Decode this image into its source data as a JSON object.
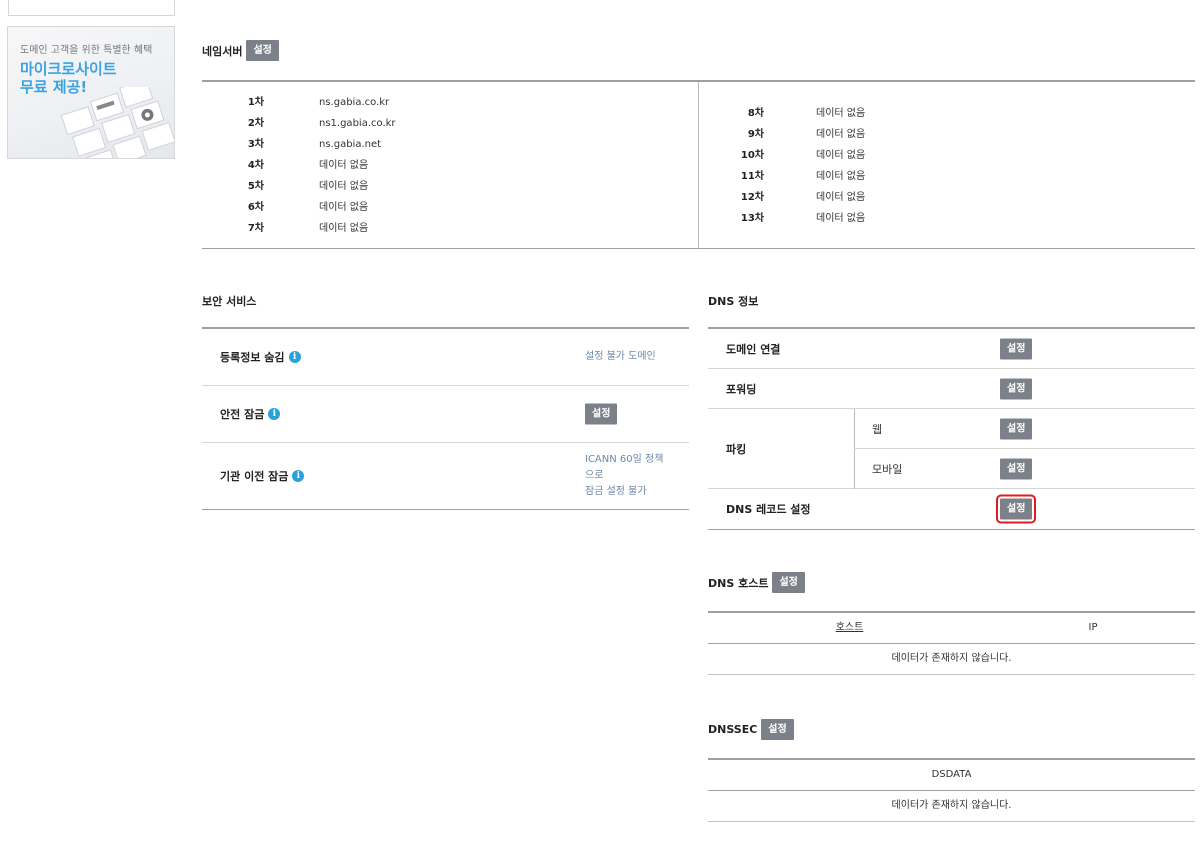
{
  "sidebar": {
    "banner": {
      "subtitle": "도메인 고객을 위한 특별한 혜택",
      "title_line1": "마이크로사이트",
      "title_line2": "무료 제공!"
    }
  },
  "nameserver": {
    "title": "네임서버",
    "button": "설정",
    "left": [
      {
        "order": "1차",
        "value": "ns.gabia.co.kr"
      },
      {
        "order": "2차",
        "value": "ns1.gabia.co.kr"
      },
      {
        "order": "3차",
        "value": "ns.gabia.net"
      },
      {
        "order": "4차",
        "value": "데이터 없음"
      },
      {
        "order": "5차",
        "value": "데이터 없음"
      },
      {
        "order": "6차",
        "value": "데이터 없음"
      },
      {
        "order": "7차",
        "value": "데이터 없음"
      }
    ],
    "right": [
      {
        "order": "8차",
        "value": "데이터 없음"
      },
      {
        "order": "9차",
        "value": "데이터 없음"
      },
      {
        "order": "10차",
        "value": "데이터 없음"
      },
      {
        "order": "11차",
        "value": "데이터 없음"
      },
      {
        "order": "12차",
        "value": "데이터 없음"
      },
      {
        "order": "13차",
        "value": "데이터 없음"
      }
    ]
  },
  "security": {
    "title": "보안 서비스",
    "rows": [
      {
        "label": "등록정보 숨김",
        "value": "설정 불가 도메인"
      },
      {
        "label": "안전 잠금",
        "button": "설정"
      },
      {
        "label": "기관 이전 잠금",
        "value_lines": [
          "ICANN 60일 정책",
          "으로",
          "잠금 설정 불가"
        ]
      }
    ]
  },
  "dns_info": {
    "title": "DNS 정보",
    "domain_connect": {
      "label": "도메인 연결",
      "button": "설정"
    },
    "forwarding": {
      "label": "포워딩",
      "button": "설정"
    },
    "parking": {
      "label": "파킹",
      "web": {
        "label": "웹",
        "button": "설정"
      },
      "mobile": {
        "label": "모바일",
        "button": "설정"
      }
    },
    "dns_record": {
      "label": "DNS 레코드 설정",
      "button": "설정"
    }
  },
  "dns_host": {
    "title": "DNS 호스트",
    "button": "설정",
    "columns": [
      "호스트",
      "IP"
    ],
    "empty": "데이터가 존재하지 않습니다."
  },
  "dnssec": {
    "title": "DNSSEC",
    "button": "설정",
    "columns": [
      "DSDATA"
    ],
    "empty": "데이터가 존재하지 않습니다."
  },
  "colors": {
    "button_bg": "#7c8088",
    "info_icon": "#29a1d9",
    "link_text": "#6f87a6",
    "highlight": "#e01b1b",
    "banner_title": "#3aa3e0"
  }
}
